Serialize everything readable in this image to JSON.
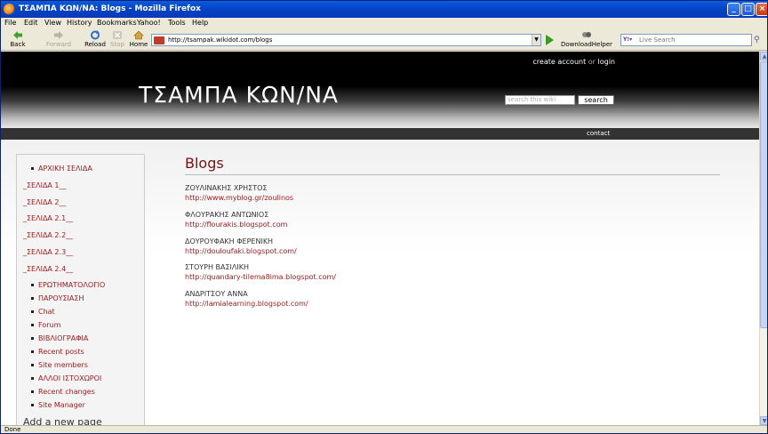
{
  "window": {
    "title": "ΤΣΑΜΠΑ ΚΩΝ/ΝΑ: Blogs - Mozilla Firefox",
    "minimize": "_",
    "maximize": "□",
    "close": "×"
  },
  "menu": [
    "File",
    "Edit",
    "View",
    "History",
    "Bookmarks",
    "Yahoo!",
    "Tools",
    "Help"
  ],
  "nav": {
    "back": "Back",
    "forward": "Forward",
    "reload": "Reload",
    "stop": "Stop",
    "home": "Home",
    "url": "http://tsampak.wikidot.com/blogs",
    "downloadhelper": "DownloadHelper",
    "search_placeholder": "Live Search"
  },
  "header": {
    "site_title": "ΤΣΑΜΠΑ ΚΩΝ/ΝΑ",
    "create_account": "create account",
    "or": "or",
    "login": "login",
    "search_placeholder": "search this wiki",
    "search_button": "search",
    "contact": "contact"
  },
  "sidebar": {
    "items": [
      "ΑΡΧΙΚΗ ΣΕΛΙΔΑ",
      "_ΣΕΛΙΔΑ 1__",
      "_ΣΕΛΙΔΑ 2__",
      "_ΣΕΛΙΔΑ 2.1__",
      "_ΣΕΛΙΔΑ 2.2__",
      "_ΣΕΛΙΔΑ 2.3__",
      "_ΣΕΛΙΔΑ 2.4__",
      "ΕΡΩΤΗΜΑΤΟΛΟΓΙΟ",
      "ΠΑΡΟΥΣΙΑΣΗ",
      "Chat",
      "Forum",
      "ΒΙΒΛΙΟΓΡΑΦΙΑ",
      "Recent posts",
      "Site members",
      "ΑΛΛΟΙ ΙΣΤΟΧΩΡΟΙ",
      "Recent changes",
      "Site Manager"
    ],
    "add_page": "Add a new page"
  },
  "main": {
    "title": "Blogs",
    "blogs": [
      {
        "name": "ΖΟΥΛΙΝΑΚΗΣ ΧΡΗΣΤΟΣ",
        "url": "http://www.myblog.gr/zoulinos"
      },
      {
        "name": "ΦΛΟΥΡΑΚΗΣ ΑΝΤΩΝΙΟΣ",
        "url": "http://flourakis.blogspot.com"
      },
      {
        "name": "ΔΟΥΡΟΥΦΑΚΗ ΦΕΡΕΝΙΚΗ",
        "url": "http://douloufaki.blogspot.com/"
      },
      {
        "name": "ΣΤΟΥΡΗ ΒΑΣΙΛΙΚΗ",
        "url": "http://quandary-tilema8ima.blogspot.com/"
      },
      {
        "name": "ΑΝΔΡΙΤΣΟΥ ΑΝΝΑ",
        "url": "http://lamialearning.blogspot.com/"
      }
    ]
  },
  "status": "Done"
}
